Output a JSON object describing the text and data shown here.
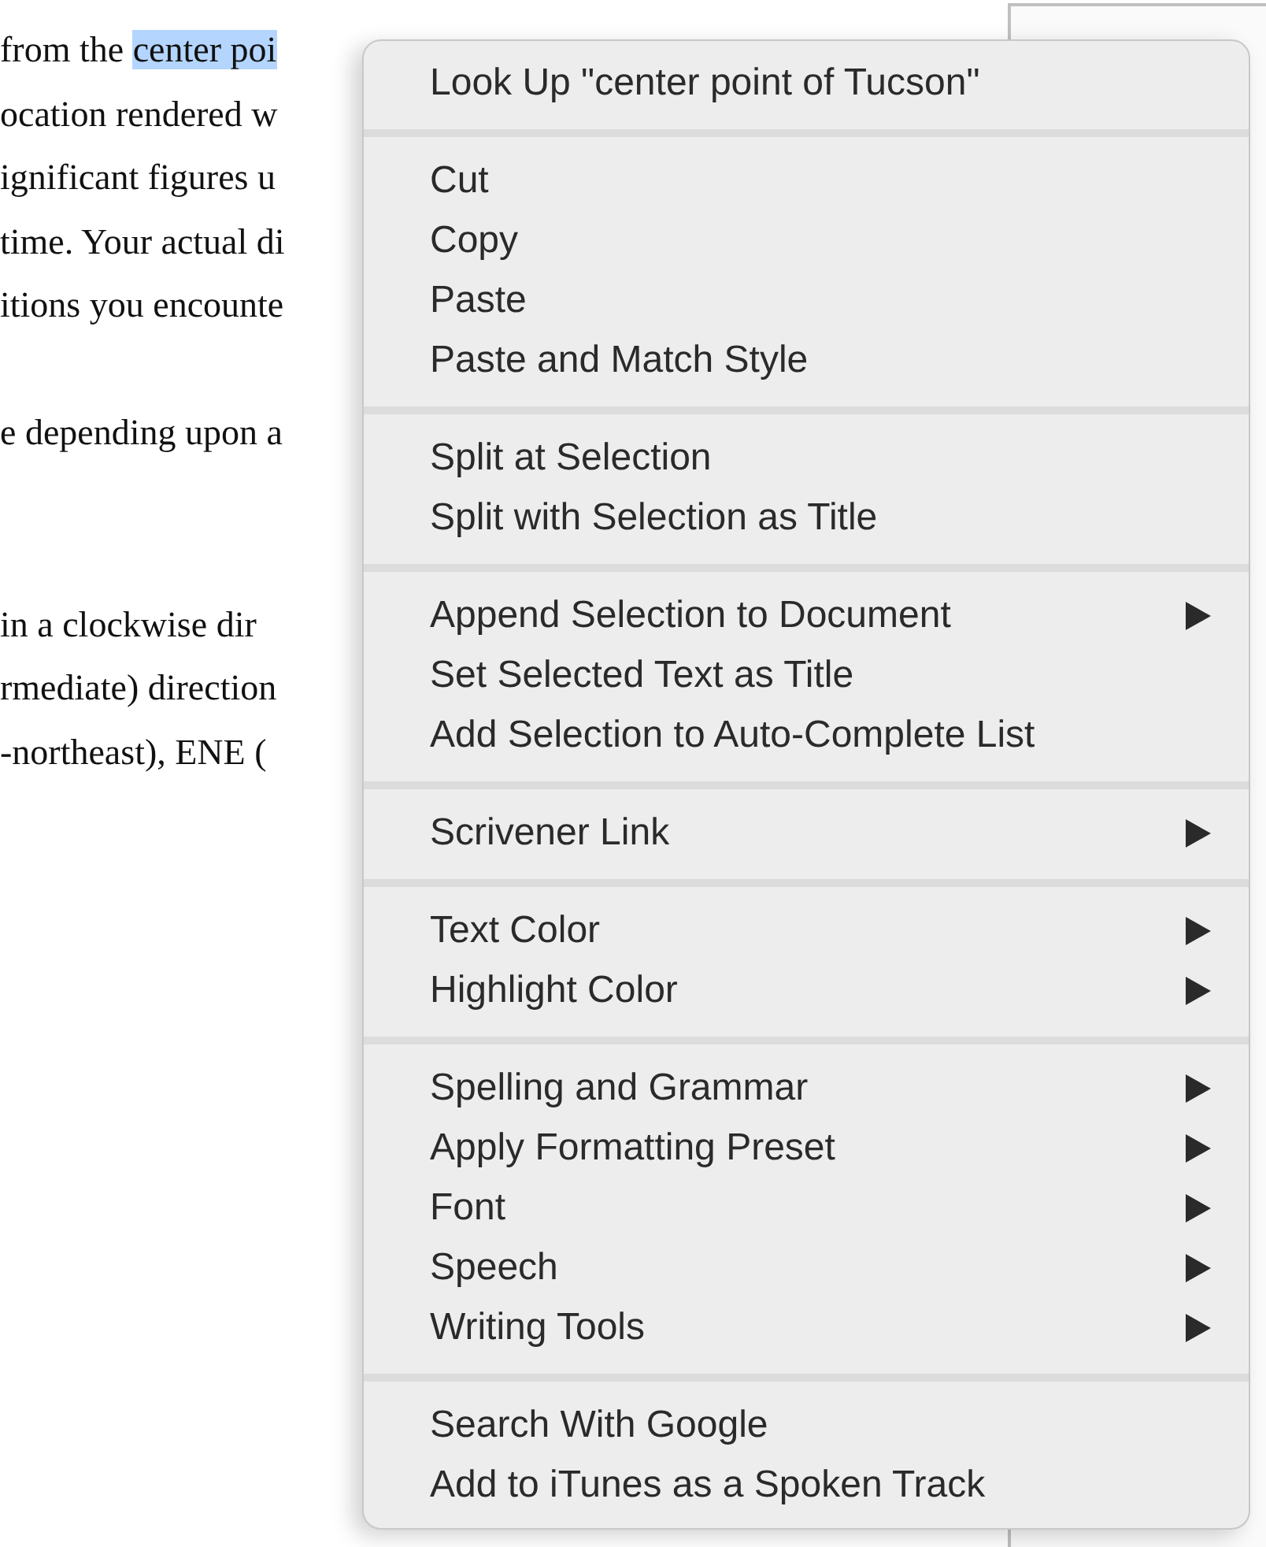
{
  "document": {
    "paragraphs": [
      {
        "lines": [
          [
            {
              "text": "from the ",
              "selected": false
            },
            {
              "text": "center poi",
              "selected": true
            }
          ],
          [
            {
              "text": "ocation rendered w",
              "selected": false
            }
          ],
          [
            {
              "text": "ignificant figures u",
              "selected": false
            }
          ],
          [
            {
              "text": "time. Your actual di",
              "selected": false
            }
          ],
          [
            {
              "text": "itions you encounte",
              "selected": false
            }
          ]
        ]
      },
      {
        "lines": [
          [
            {
              "text": "e depending upon a",
              "selected": false
            }
          ]
        ]
      },
      {
        "lines": [
          [
            {
              "text": "in a clockwise dir",
              "selected": false
            }
          ],
          [
            {
              "text": "rmediate) direction",
              "selected": false
            }
          ],
          [
            {
              "text": "-northeast), ENE (",
              "selected": false
            }
          ]
        ]
      }
    ]
  },
  "context_menu": {
    "groups": [
      {
        "items": [
          {
            "label": "Look Up \"center point of Tucson\"",
            "submenu": false
          }
        ]
      },
      {
        "items": [
          {
            "label": "Cut",
            "submenu": false
          },
          {
            "label": "Copy",
            "submenu": false
          },
          {
            "label": "Paste",
            "submenu": false
          },
          {
            "label": "Paste and Match Style",
            "submenu": false
          }
        ]
      },
      {
        "items": [
          {
            "label": "Split at Selection",
            "submenu": false
          },
          {
            "label": "Split with Selection as Title",
            "submenu": false
          }
        ]
      },
      {
        "items": [
          {
            "label": "Append Selection to Document",
            "submenu": true
          },
          {
            "label": "Set Selected Text as Title",
            "submenu": false
          },
          {
            "label": "Add Selection to Auto-Complete List",
            "submenu": false
          }
        ]
      },
      {
        "items": [
          {
            "label": "Scrivener Link",
            "submenu": true
          }
        ]
      },
      {
        "items": [
          {
            "label": "Text Color",
            "submenu": true
          },
          {
            "label": "Highlight Color",
            "submenu": true
          }
        ]
      },
      {
        "items": [
          {
            "label": "Spelling and Grammar",
            "submenu": true
          },
          {
            "label": "Apply Formatting Preset",
            "submenu": true
          },
          {
            "label": "Font",
            "submenu": true
          },
          {
            "label": "Speech",
            "submenu": true
          },
          {
            "label": "Writing Tools",
            "submenu": true
          }
        ]
      },
      {
        "items": [
          {
            "label": "Search With Google",
            "submenu": false
          },
          {
            "label": "Add to iTunes as a Spoken Track",
            "submenu": false
          }
        ]
      }
    ]
  }
}
